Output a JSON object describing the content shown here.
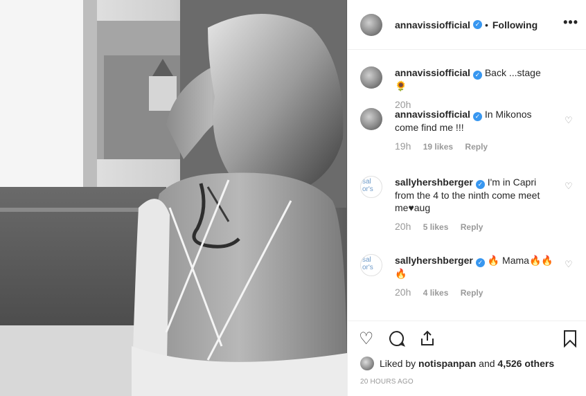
{
  "header": {
    "username": "annavissiofficial",
    "verified_icon": "verified-badge-icon",
    "separator": "•",
    "follow_status": "Following",
    "more_icon": "•••"
  },
  "comments": [
    {
      "username": "annavissiofficial",
      "text": "Back ...stage 🌻",
      "time": "20h",
      "likes": "",
      "reply": ""
    },
    {
      "username": "annavissiofficial",
      "text": "In Mikonos come find me !!!",
      "time": "19h",
      "likes": "19 likes",
      "reply": "Reply"
    },
    {
      "username": "sallyhershberger",
      "text": "I'm in Capri from the 4 to the ninth come meet me♥aug",
      "time": "20h",
      "likes": "5 likes",
      "reply": "Reply",
      "avatar_alt": "sally hersh berger's profile"
    },
    {
      "username": "sallyhershberger",
      "text": "🔥 Mama🔥🔥 🔥",
      "time": "20h",
      "likes": "4 likes",
      "reply": "Reply",
      "avatar_alt": "sally hersh berger's profile"
    }
  ],
  "avatar_alt_text": "sal\nor's",
  "actions": {
    "like_icon": "heart-outline-icon",
    "comment_icon": "comment-bubble-icon",
    "share_icon": "share-icon",
    "save_icon": "bookmark-icon"
  },
  "liked_by": {
    "prefix": "Liked by",
    "user": "notispanpan",
    "middle": "and",
    "count": "4,526 others"
  },
  "posted_ago": "20 HOURS AGO",
  "colors": {
    "verified": "#3897f0",
    "meta_grey": "#999999",
    "text": "#262626",
    "border": "#efefef"
  }
}
